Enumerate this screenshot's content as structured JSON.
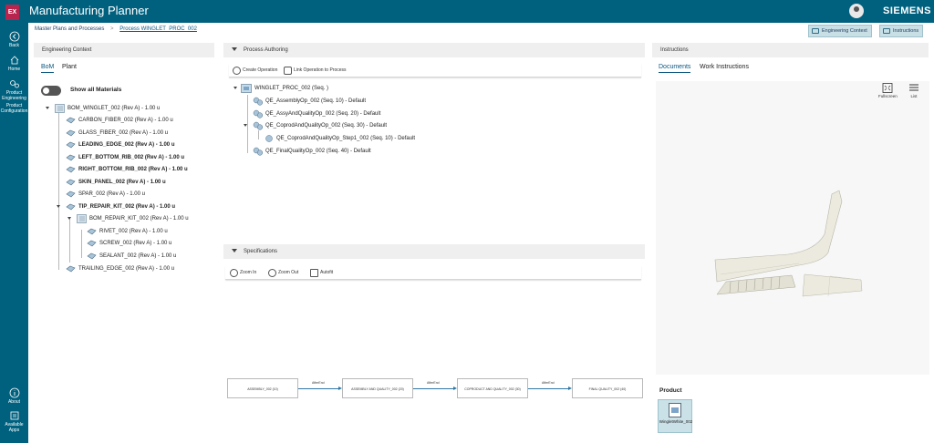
{
  "app": {
    "logo_text": "EX",
    "title": "Manufacturing Planner",
    "brand": "SIEMENS"
  },
  "nav": {
    "back": "Back",
    "home": "Home",
    "product_engineering": "Product Engineering",
    "product_configuration": "Product Configuration",
    "about": "About",
    "available_apps": "Available Apps"
  },
  "breadcrumb": {
    "root": "Master Plans and Processes",
    "separator": ">",
    "current": "Process WINGLET_PROC_002"
  },
  "header_buttons": {
    "engineering_context": "Engineering Context",
    "instructions": "Instructions"
  },
  "engineering_context": {
    "title": "Engineering Context",
    "tabs": [
      "BoM",
      "Plant"
    ],
    "active_tab": "BoM",
    "show_all_materials": "Show all Materials",
    "tree": [
      "BOM_WINGLET_002 (Rev A) - 1.00 u",
      "CARBON_FIBER_002 (Rev A) - 1.00 u",
      "GLASS_FIBER_002 (Rev A) - 1.00 u",
      "LEADING_EDGE_002 (Rev A) - 1.00 u",
      "LEFT_BOTTOM_RIB_002 (Rev A) - 1.00 u",
      "RIGHT_BOTTOM_RIB_002 (Rev A) - 1.00 u",
      "SKIN_PANEL_002 (Rev A) - 1.00 u",
      "SPAR_002 (Rev A) - 1.00 u",
      "TIP_REPAIR_KIT_002 (Rev A) - 1.00 u",
      "BOM_REPAIR_KIT_002 (Rev A) - 1.00 u",
      "RIVET_002 (Rev A) - 1.00 u",
      "SCREW_002 (Rev A) - 1.00 u",
      "SEALANT_002 (Rev A) - 1.00 u",
      "TRAILING_EDGE_002 (Rev A) - 1.00 u"
    ]
  },
  "process_authoring": {
    "title": "Process Authoring",
    "toolbar": {
      "create_operation": "Create Operation",
      "link_operation": "Link Operation to Process"
    },
    "tree": [
      "WINGLET_PROC_002 (Seq. )",
      "QE_AssemblyOp_002 (Seq. 10) - Default",
      "QE_AssyAndQualityOp_002 (Seq. 20) - Default",
      "QE_CoprodAndQualityOp_002 (Seq. 30) - Default",
      "QE_CoprodAndQualityOp_Step1_002 (Seq. 10) - Default",
      "QE_FinalQualityOp_002 (Seq. 40) - Default"
    ]
  },
  "specifications": {
    "title": "Specifications",
    "toolbar": {
      "zoom_in": "Zoom In",
      "zoom_out": "Zoom Out",
      "autofit": "Autofit"
    },
    "flow": {
      "nodes": [
        "ASSEMBLY_002 (10)",
        "ASSEMBLY AND QUALITY_002 (20)",
        "COPRODUCT AND QUALITY_002 (30)",
        "FINAL QUALITY_002 (40)"
      ],
      "edges": [
        "AfterEnd",
        "AfterEnd",
        "AfterEnd"
      ]
    }
  },
  "instructions": {
    "title": "Instructions",
    "tabs": [
      "Documents",
      "Work Instructions"
    ],
    "active_tab": "Documents",
    "viewer": {
      "fullscreen": "Fullscreen",
      "list": "List"
    },
    "product_label": "Product",
    "product_file": "WingletWhite_002"
  },
  "colors": {
    "topbar": "#00617f",
    "accent": "#0a5780",
    "flow_line": "#2f77a5",
    "logo": "#b7254e"
  }
}
